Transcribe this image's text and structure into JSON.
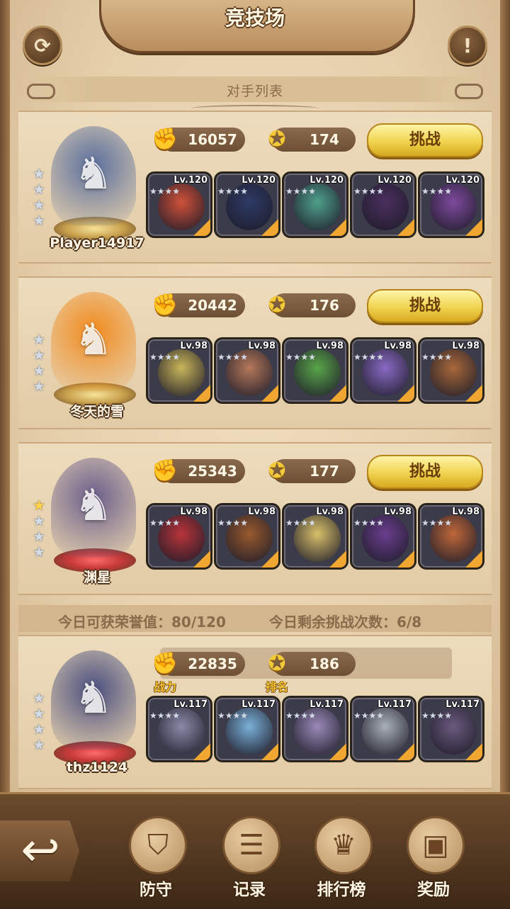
{
  "header": {
    "title": "竞技场",
    "refresh_icon": "⟳",
    "info_icon": "!"
  },
  "section": {
    "title": "对手列表"
  },
  "opponents": [
    {
      "name": "Player14917",
      "power": "16057",
      "rank": "174",
      "challenge_label": "挑战",
      "avatar_color": "#5a6e9c",
      "heroes": [
        {
          "level": "Lv.120",
          "color": "#d0513a"
        },
        {
          "level": "Lv.120",
          "color": "#2e3b66"
        },
        {
          "level": "Lv.120",
          "color": "#4fa08b"
        },
        {
          "level": "Lv.120",
          "color": "#4a2f5e"
        },
        {
          "level": "Lv.120",
          "color": "#7e4a9e"
        }
      ]
    },
    {
      "name": "冬天的雪",
      "power": "20442",
      "rank": "176",
      "challenge_label": "挑战",
      "avatar_color": "#f08a1e",
      "heroes": [
        {
          "level": "Lv.98",
          "color": "#c9b65a"
        },
        {
          "level": "Lv.98",
          "color": "#b5785a"
        },
        {
          "level": "Lv.98",
          "color": "#5aa64a"
        },
        {
          "level": "Lv.98",
          "color": "#8a6ac4"
        },
        {
          "level": "Lv.98",
          "color": "#a8683a"
        }
      ]
    },
    {
      "name": "渊星",
      "power": "25343",
      "rank": "177",
      "challenge_label": "挑战",
      "avatar_color": "#6b5e8a",
      "heroes": [
        {
          "level": "Lv.98",
          "color": "#b8343a"
        },
        {
          "level": "Lv.98",
          "color": "#9a5a2e"
        },
        {
          "level": "Lv.98",
          "color": "#d8c06a"
        },
        {
          "level": "Lv.98",
          "color": "#6a3e8e"
        },
        {
          "level": "Lv.98",
          "color": "#c0683a"
        }
      ]
    }
  ],
  "daily": {
    "honor": "今日可获荣誉值：80/120",
    "remaining": "今日剩余挑战次数：6/8"
  },
  "me": {
    "name": "thz1124",
    "power": "22835",
    "rank": "186",
    "power_caption": "战力",
    "rank_caption": "排名",
    "avatar_color": "#4a4f7e",
    "heroes": [
      {
        "level": "Lv.117",
        "color": "#8a8aa8"
      },
      {
        "level": "Lv.117",
        "color": "#7ab0d8"
      },
      {
        "level": "Lv.117",
        "color": "#9a8ab8"
      },
      {
        "level": "Lv.117",
        "color": "#a8b0b8"
      },
      {
        "level": "Lv.117",
        "color": "#6a5a7e"
      }
    ]
  },
  "nav": [
    {
      "label": "防守",
      "icon": "shield-icon",
      "glyph": "⛉"
    },
    {
      "label": "记录",
      "icon": "scroll-icon",
      "glyph": "☰"
    },
    {
      "label": "排行榜",
      "icon": "trophy-icon",
      "glyph": "♛"
    },
    {
      "label": "奖励",
      "icon": "chest-icon",
      "glyph": "▣"
    }
  ],
  "back_icon": "↩"
}
